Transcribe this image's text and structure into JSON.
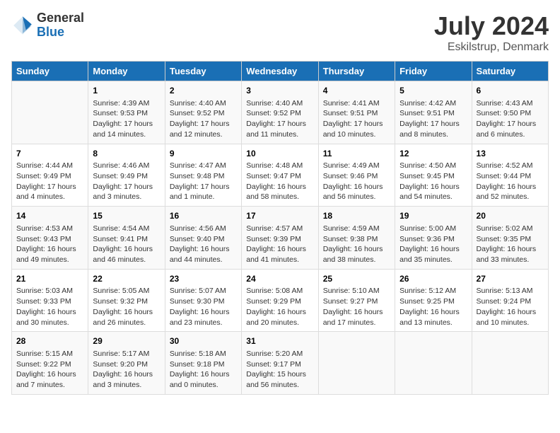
{
  "header": {
    "logo_general": "General",
    "logo_blue": "Blue",
    "title": "July 2024",
    "subtitle": "Eskilstrup, Denmark"
  },
  "calendar": {
    "days_of_week": [
      "Sunday",
      "Monday",
      "Tuesday",
      "Wednesday",
      "Thursday",
      "Friday",
      "Saturday"
    ],
    "weeks": [
      [
        {
          "day": "",
          "content": ""
        },
        {
          "day": "1",
          "content": "Sunrise: 4:39 AM\nSunset: 9:53 PM\nDaylight: 17 hours\nand 14 minutes."
        },
        {
          "day": "2",
          "content": "Sunrise: 4:40 AM\nSunset: 9:52 PM\nDaylight: 17 hours\nand 12 minutes."
        },
        {
          "day": "3",
          "content": "Sunrise: 4:40 AM\nSunset: 9:52 PM\nDaylight: 17 hours\nand 11 minutes."
        },
        {
          "day": "4",
          "content": "Sunrise: 4:41 AM\nSunset: 9:51 PM\nDaylight: 17 hours\nand 10 minutes."
        },
        {
          "day": "5",
          "content": "Sunrise: 4:42 AM\nSunset: 9:51 PM\nDaylight: 17 hours\nand 8 minutes."
        },
        {
          "day": "6",
          "content": "Sunrise: 4:43 AM\nSunset: 9:50 PM\nDaylight: 17 hours\nand 6 minutes."
        }
      ],
      [
        {
          "day": "7",
          "content": "Sunrise: 4:44 AM\nSunset: 9:49 PM\nDaylight: 17 hours\nand 4 minutes."
        },
        {
          "day": "8",
          "content": "Sunrise: 4:46 AM\nSunset: 9:49 PM\nDaylight: 17 hours\nand 3 minutes."
        },
        {
          "day": "9",
          "content": "Sunrise: 4:47 AM\nSunset: 9:48 PM\nDaylight: 17 hours\nand 1 minute."
        },
        {
          "day": "10",
          "content": "Sunrise: 4:48 AM\nSunset: 9:47 PM\nDaylight: 16 hours\nand 58 minutes."
        },
        {
          "day": "11",
          "content": "Sunrise: 4:49 AM\nSunset: 9:46 PM\nDaylight: 16 hours\nand 56 minutes."
        },
        {
          "day": "12",
          "content": "Sunrise: 4:50 AM\nSunset: 9:45 PM\nDaylight: 16 hours\nand 54 minutes."
        },
        {
          "day": "13",
          "content": "Sunrise: 4:52 AM\nSunset: 9:44 PM\nDaylight: 16 hours\nand 52 minutes."
        }
      ],
      [
        {
          "day": "14",
          "content": "Sunrise: 4:53 AM\nSunset: 9:43 PM\nDaylight: 16 hours\nand 49 minutes."
        },
        {
          "day": "15",
          "content": "Sunrise: 4:54 AM\nSunset: 9:41 PM\nDaylight: 16 hours\nand 46 minutes."
        },
        {
          "day": "16",
          "content": "Sunrise: 4:56 AM\nSunset: 9:40 PM\nDaylight: 16 hours\nand 44 minutes."
        },
        {
          "day": "17",
          "content": "Sunrise: 4:57 AM\nSunset: 9:39 PM\nDaylight: 16 hours\nand 41 minutes."
        },
        {
          "day": "18",
          "content": "Sunrise: 4:59 AM\nSunset: 9:38 PM\nDaylight: 16 hours\nand 38 minutes."
        },
        {
          "day": "19",
          "content": "Sunrise: 5:00 AM\nSunset: 9:36 PM\nDaylight: 16 hours\nand 35 minutes."
        },
        {
          "day": "20",
          "content": "Sunrise: 5:02 AM\nSunset: 9:35 PM\nDaylight: 16 hours\nand 33 minutes."
        }
      ],
      [
        {
          "day": "21",
          "content": "Sunrise: 5:03 AM\nSunset: 9:33 PM\nDaylight: 16 hours\nand 30 minutes."
        },
        {
          "day": "22",
          "content": "Sunrise: 5:05 AM\nSunset: 9:32 PM\nDaylight: 16 hours\nand 26 minutes."
        },
        {
          "day": "23",
          "content": "Sunrise: 5:07 AM\nSunset: 9:30 PM\nDaylight: 16 hours\nand 23 minutes."
        },
        {
          "day": "24",
          "content": "Sunrise: 5:08 AM\nSunset: 9:29 PM\nDaylight: 16 hours\nand 20 minutes."
        },
        {
          "day": "25",
          "content": "Sunrise: 5:10 AM\nSunset: 9:27 PM\nDaylight: 16 hours\nand 17 minutes."
        },
        {
          "day": "26",
          "content": "Sunrise: 5:12 AM\nSunset: 9:25 PM\nDaylight: 16 hours\nand 13 minutes."
        },
        {
          "day": "27",
          "content": "Sunrise: 5:13 AM\nSunset: 9:24 PM\nDaylight: 16 hours\nand 10 minutes."
        }
      ],
      [
        {
          "day": "28",
          "content": "Sunrise: 5:15 AM\nSunset: 9:22 PM\nDaylight: 16 hours\nand 7 minutes."
        },
        {
          "day": "29",
          "content": "Sunrise: 5:17 AM\nSunset: 9:20 PM\nDaylight: 16 hours\nand 3 minutes."
        },
        {
          "day": "30",
          "content": "Sunrise: 5:18 AM\nSunset: 9:18 PM\nDaylight: 16 hours\nand 0 minutes."
        },
        {
          "day": "31",
          "content": "Sunrise: 5:20 AM\nSunset: 9:17 PM\nDaylight: 15 hours\nand 56 minutes."
        },
        {
          "day": "",
          "content": ""
        },
        {
          "day": "",
          "content": ""
        },
        {
          "day": "",
          "content": ""
        }
      ]
    ]
  }
}
